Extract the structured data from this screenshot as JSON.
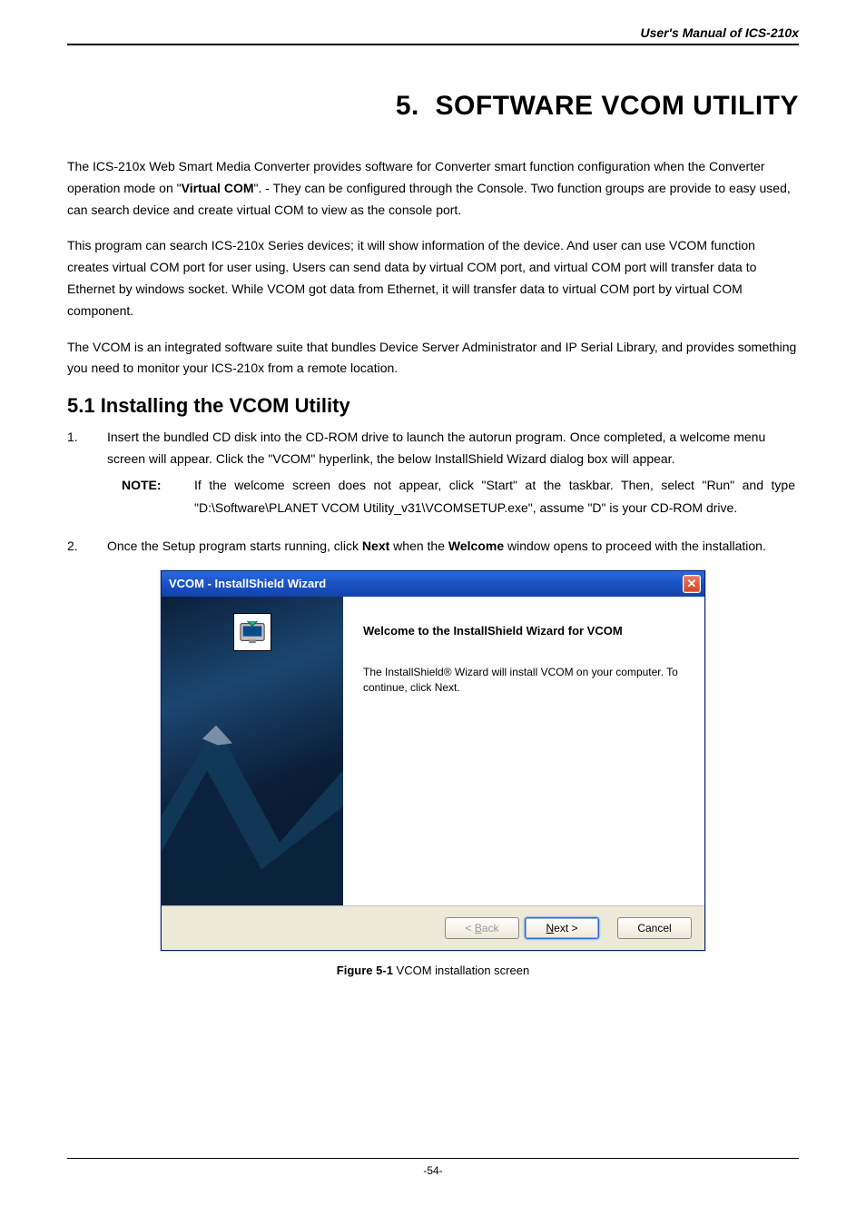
{
  "header": "User's Manual of ICS-210x",
  "chapterTitle": "5.  SOFTWARE VCOM UTILITY",
  "intro1_a": "The ICS-210x Web Smart Media Converter provides software for Converter smart function configuration when the Converter operation mode on \"",
  "intro1_bold": "Virtual COM",
  "intro1_b": "\". - They can be configured through the Console.  Two function groups are provide to easy used, can search device and create virtual COM to view as the console port.",
  "intro2": "This program can search ICS-210x Series devices; it will show information of the device. And user can use VCOM function creates virtual COM port for user using. Users can send data by virtual COM port, and virtual COM port will transfer data to Ethernet by windows socket. While VCOM got data from Ethernet, it will transfer data to virtual COM port by virtual COM component.",
  "intro3": "The VCOM is an integrated software suite that bundles Device Server Administrator and IP Serial Library, and provides something you need to monitor your ICS-210x from a remote location.",
  "sectionTitle": "5.1 Installing the VCOM Utility",
  "step1_num": "1.",
  "step1": "Insert the bundled CD disk into the CD-ROM drive to launch the autorun program. Once completed, a welcome menu screen will appear. Click the \"VCOM\" hyperlink, the below InstallShield Wizard dialog box will appear.",
  "noteLabel": "NOTE:",
  "noteBody": "If the welcome screen does not appear, click \"Start\" at the taskbar. Then, select \"Run\" and type \"D:\\Software\\PLANET VCOM Utility_v31\\VCOMSETUP.exe\", assume \"D\" is your CD-ROM drive.",
  "step2_num": "2.",
  "step2_a": "Once the Setup program starts running, click ",
  "step2_b1": "Next",
  "step2_b": " when the ",
  "step2_b2": "Welcome",
  "step2_c": " window opens to proceed with the installation.",
  "wizard": {
    "title": "VCOM - InstallShield Wizard",
    "heading": "Welcome to the InstallShield Wizard for VCOM",
    "body": "The InstallShield® Wizard will install VCOM on your computer.  To continue, click Next.",
    "back": "< Back",
    "next": "Next >",
    "cancel": "Cancel"
  },
  "captionBold": "Figure 5-1",
  "captionRest": " VCOM installation screen",
  "pageNum": "-54-"
}
